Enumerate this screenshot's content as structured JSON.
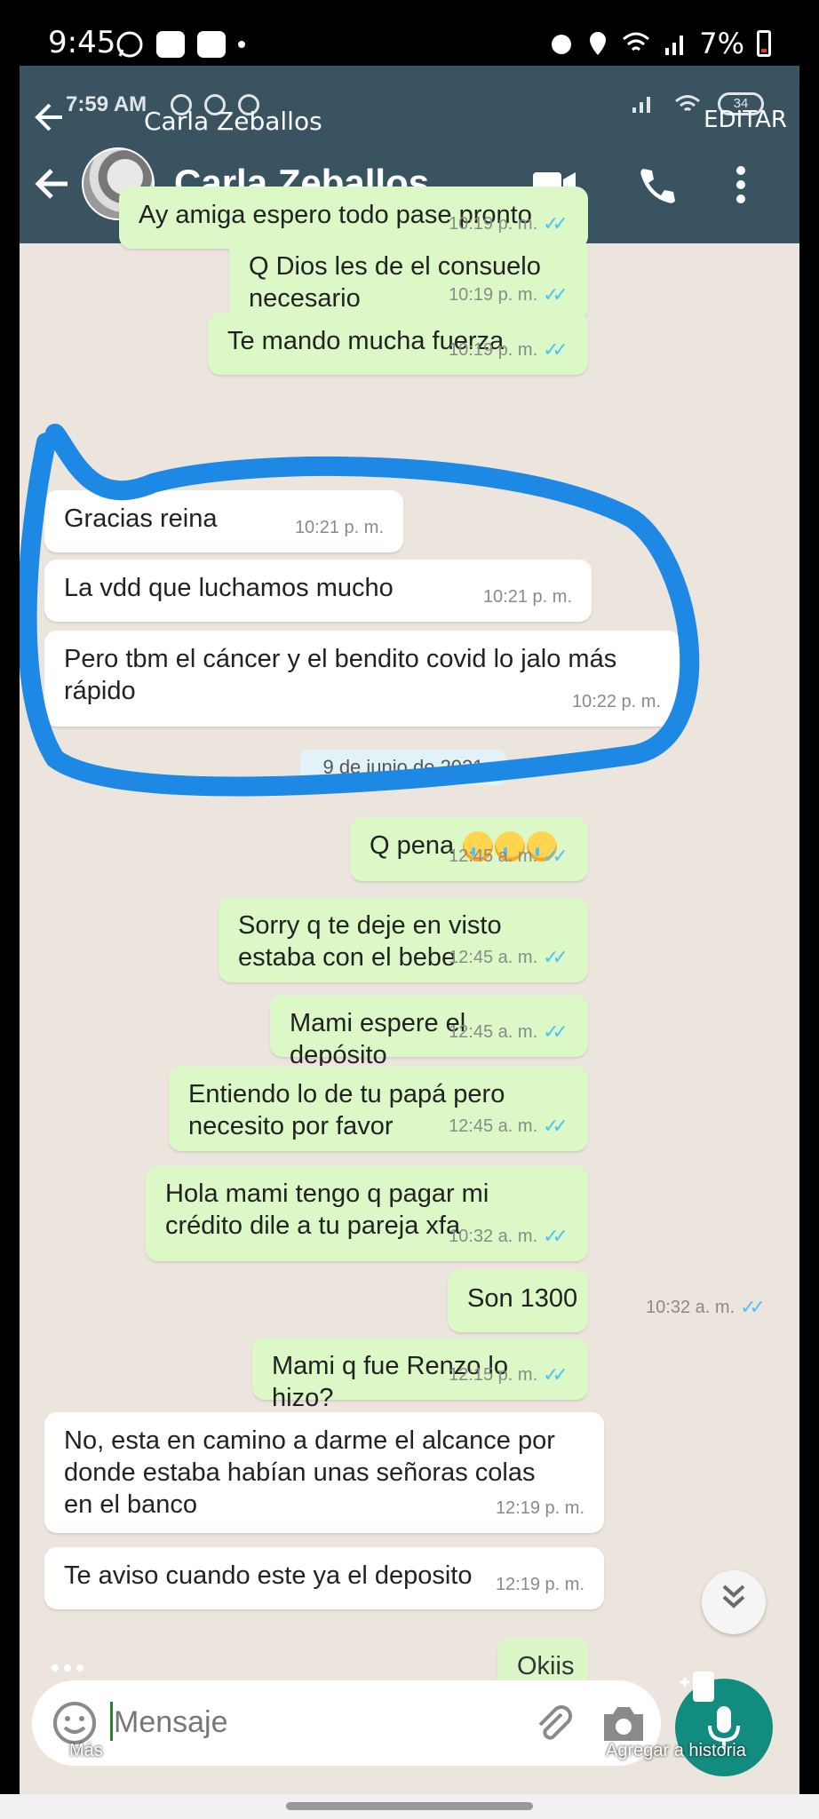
{
  "status_bar": {
    "time": "9:45",
    "battery": "7%"
  },
  "overlay": {
    "title": "Carla Zeballos",
    "edit_label": "EDITAR",
    "more_label": "Más",
    "story_label": "Agregar a historia"
  },
  "inner_status": {
    "time": "7:59 AM",
    "badge": "34"
  },
  "chat": {
    "contact_name": "Carla Zeballos",
    "date_chip": "9 de junio de 2021"
  },
  "messages": [
    {
      "text": "Ay amiga espero todo pase pronto",
      "time": "10:19 p. m."
    },
    {
      "text": "Q Dios les de el consuelo necesario",
      "time": "10:19 p. m."
    },
    {
      "text": "Te mando mucha fuerza",
      "time": "10:19 p. m."
    },
    {
      "text": "Gracias reina",
      "time": "10:21 p. m."
    },
    {
      "text": "La vdd que luchamos mucho",
      "time": "10:21 p. m."
    },
    {
      "text": "Pero tbm el cáncer y el bendito covid lo jalo más rápido",
      "time": "10:22 p. m."
    },
    {
      "text": "Q pena",
      "time": "12:45 a. m."
    },
    {
      "text": "Sorry q te deje en visto estaba con el bebe",
      "time": "12:45 a. m."
    },
    {
      "text": "Mami espere el depósito",
      "time": "12:45 a. m."
    },
    {
      "text": "Entiendo lo de tu papá pero necesito por favor",
      "time": "12:45 a. m."
    },
    {
      "text": "Hola mami tengo q pagar mi crédito dile a tu pareja xfa",
      "time": "10:32 a. m."
    },
    {
      "text": "Son 1300",
      "time": "10:32 a. m."
    },
    {
      "text": "Mami q fue Renzo lo hizo?",
      "time": "12:15 p. m."
    },
    {
      "text": "No, esta en camino a darme el alcance por donde estaba habían unas señoras colas en el banco",
      "time": "12:19 p. m."
    },
    {
      "text": "Te aviso cuando este ya el deposito",
      "time": "12:19 p. m."
    },
    {
      "text": "Okiis",
      "time": ""
    }
  ],
  "input": {
    "placeholder": "Mensaje"
  },
  "colors": {
    "header": "#3a5360",
    "outgoing": "#dcf8c6",
    "incoming": "#ffffff",
    "wallpaper": "#ece5dd",
    "marker": "#1e88e5",
    "mic": "#128c7e"
  }
}
